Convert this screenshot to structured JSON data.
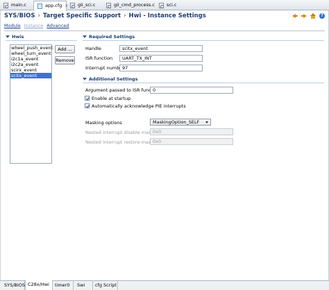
{
  "editor_tabs": [
    {
      "label": "main.c",
      "icon": "c-file-icon"
    },
    {
      "label": "app.cfg",
      "icon": "cfg-file-icon"
    },
    {
      "label": "gii_sci.c",
      "icon": "c-file-icon"
    },
    {
      "label": "gii_cmd_process.c",
      "icon": "c-file-icon"
    },
    {
      "label": "sci.c",
      "icon": "c-file-icon"
    }
  ],
  "close_glyph": "×",
  "breadcrumb": {
    "part1": "SYS/BIOS",
    "separator": "›",
    "part2": "Target Specific Support",
    "part3": "Hwi - Instance Settings"
  },
  "toolbar": {
    "help_glyph": "?"
  },
  "view_links": {
    "module": "Module",
    "instance": "Instance",
    "advanced": "Advanced"
  },
  "hwis": {
    "title": "Hwis",
    "items": [
      "wheel_push_event",
      "wheel_turn_event",
      "i2c1a_event",
      "i2c2a_event",
      "scirx_event",
      "scitx_event"
    ],
    "selected_index": 5,
    "add_label": "Add ...",
    "remove_label": "Remove"
  },
  "required": {
    "title": "Required Settings",
    "handle_label": "Handle",
    "handle_value": "scitx_event",
    "isr_label": "ISR function",
    "isr_value": "UART_TX_INT",
    "irq_label": "Interrupt number",
    "irq_value": "97"
  },
  "additional": {
    "title": "Additional Settings",
    "arg_label": "Argument passed to ISR function",
    "arg_value": "0",
    "enable_label": "Enable at startup",
    "enable_checked": true,
    "ack_label": "Automatically acknowledge PIE interrupts",
    "ack_checked": true,
    "masking_label": "Masking options",
    "masking_value": "MaskingOption_SELF",
    "disable_mask_label": "Nested interrupt disable mask",
    "disable_mask_value": "0x0",
    "restore_mask_label": "Nested interrupt restore mask",
    "restore_mask_value": "0x0"
  },
  "bottom_tabs": [
    "SYS/BIOS",
    "C28x/Hwi",
    "timer0",
    "Swi",
    "cfg Script"
  ],
  "active_bottom_tab": "C28x/Hwi"
}
